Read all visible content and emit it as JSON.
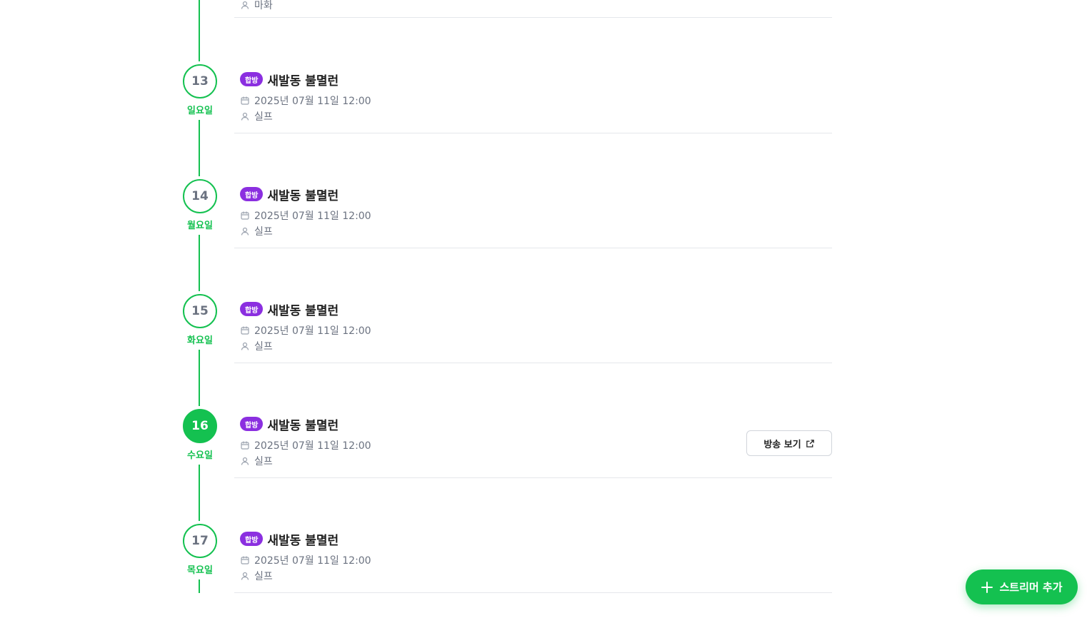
{
  "top_partial": {
    "streamer": "마화"
  },
  "entries": [
    {
      "day": "13",
      "weekday": "일요일",
      "badge": "합방",
      "title": "새발동 불멸런",
      "datetime": "2025년 07월 11일 12:00",
      "streamer": "실프",
      "active": false
    },
    {
      "day": "14",
      "weekday": "월요일",
      "badge": "합방",
      "title": "새발동 불멸런",
      "datetime": "2025년 07월 11일 12:00",
      "streamer": "실프",
      "active": false
    },
    {
      "day": "15",
      "weekday": "화요일",
      "badge": "합방",
      "title": "새발동 불멸런",
      "datetime": "2025년 07월 11일 12:00",
      "streamer": "실프",
      "active": false
    },
    {
      "day": "16",
      "weekday": "수요일",
      "badge": "합방",
      "title": "새발동 불멸런",
      "datetime": "2025년 07월 11일 12:00",
      "streamer": "실프",
      "active": true,
      "button": "방송 보기"
    },
    {
      "day": "17",
      "weekday": "목요일",
      "badge": "합방",
      "title": "새발동 불멸런",
      "datetime": "2025년 07월 11일 12:00",
      "streamer": "실프",
      "active": false
    }
  ],
  "fab": {
    "label": "스트리머 추가",
    "icon": "plus-icon"
  },
  "colors": {
    "accent": "#14c150",
    "badge": "#8b2fe0"
  },
  "icons": {
    "date": "calendar-icon",
    "person": "user-icon",
    "external": "external-link-icon"
  }
}
